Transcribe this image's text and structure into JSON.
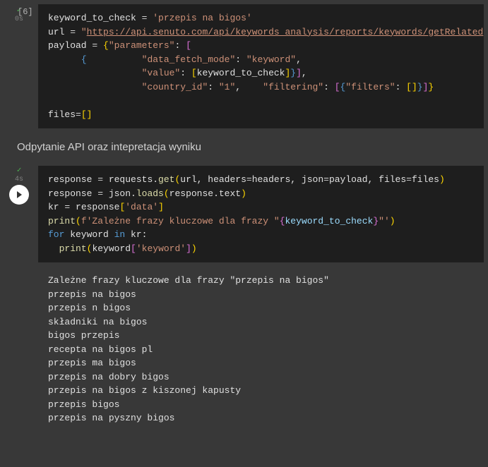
{
  "cell1": {
    "check": "✓",
    "timing": "0s",
    "exec_count": "[6]",
    "code_html": "keyword_to_check <span class='tok-op'>=</span> <span class='tok-str'>'przepis na bigos'</span>\nurl <span class='tok-op'>=</span> <span class='tok-str'>\"</span><span class='tok-url'>https://api.senuto.com/api/keywords_analysis/reports/keywords/getRelated</span><span class='tok-str'>\"</span>\npayload <span class='tok-op'>=</span> <span class='tok-brace'>{</span><span class='tok-str'>\"parameters\"</span>: <span class='tok-brkt'>[</span>\n      <span class='tok-brkt2'>{</span>          <span class='tok-str'>\"data_fetch_mode\"</span>: <span class='tok-str'>\"keyword\"</span>,\n                 <span class='tok-str'>\"value\"</span>: <span class='tok-paren'>[</span>keyword_to_check<span class='tok-paren'>]</span><span class='tok-brkt2'>}</span><span class='tok-brkt'>]</span>,\n                 <span class='tok-str'>\"country_id\"</span>: <span class='tok-str'>\"1\"</span>,    <span class='tok-str'>\"filtering\"</span>: <span class='tok-brkt'>[</span><span class='tok-brkt2'>{</span><span class='tok-str'>\"filters\"</span>: <span class='tok-paren'>[</span><span class='tok-paren'>]</span><span class='tok-brkt2'>}</span><span class='tok-brkt'>]</span><span class='tok-brace'>}</span>\n\nfiles<span class='tok-op'>=</span><span class='tok-brace'>[</span><span class='tok-brace'>]</span>"
  },
  "heading": "Odpytanie API oraz intepretacja wyniku",
  "cell2": {
    "check": "✓",
    "timing": "4s",
    "code_html": "response <span class='tok-op'>=</span> requests.<span class='tok-fn'>get</span><span class='tok-paren'>(</span>url, headers<span class='tok-op'>=</span>headers, json<span class='tok-op'>=</span>payload, files<span class='tok-op'>=</span>files<span class='tok-paren'>)</span>\nresponse <span class='tok-op'>=</span> json.<span class='tok-fn'>loads</span><span class='tok-paren'>(</span>response.text<span class='tok-paren'>)</span>\nkr <span class='tok-op'>=</span> response<span class='tok-paren'>[</span><span class='tok-str'>'data'</span><span class='tok-paren'>]</span>\n<span class='tok-fn'>print</span><span class='tok-paren'>(</span><span class='tok-str'>f'Zależne frazy kluczowe dla frazy \"</span><span class='tok-brkt'>{</span><span class='tok-fvar'>keyword_to_check</span><span class='tok-brkt'>}</span><span class='tok-str'>\"'</span><span class='tok-paren'>)</span>\n<span class='tok-kw'>for</span> keyword <span class='tok-kw'>in</span> kr:\n  <span class='tok-fn'>print</span><span class='tok-paren'>(</span>keyword<span class='tok-brkt'>[</span><span class='tok-str'>'keyword'</span><span class='tok-brkt'>]</span><span class='tok-paren'>)</span>\n"
  },
  "output": "Zależne frazy kluczowe dla frazy \"przepis na bigos\"\nprzepis na bigos\nprzepis n bigos\nskładniki na bigos\nbigos przepis\nrecepta na bigos pl\nprzepis ma bigos\nprzepis na dobry bigos\nprzepis na bigos z kiszonej kapusty\nprzepis bigos\nprzepis na pyszny bigos"
}
